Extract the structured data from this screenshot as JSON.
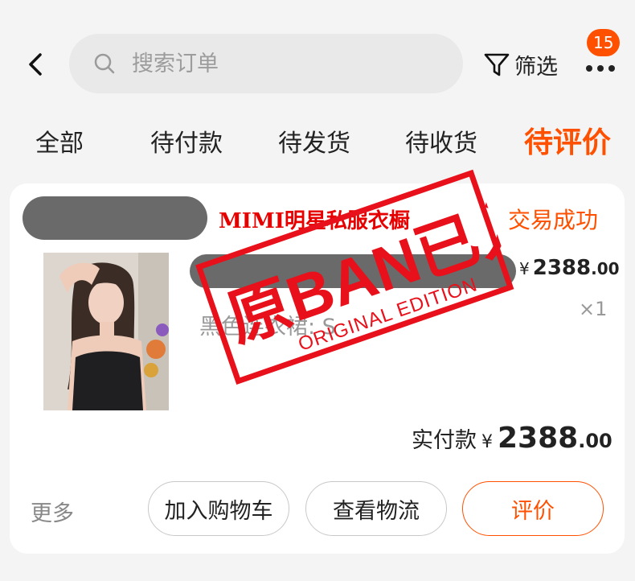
{
  "search": {
    "placeholder": "搜索订单"
  },
  "header": {
    "filter_label": "筛选",
    "more_badge": "15"
  },
  "tabs": [
    {
      "label": "全部",
      "active": false
    },
    {
      "label": "待付款",
      "active": false
    },
    {
      "label": "待发货",
      "active": false
    },
    {
      "label": "待收货",
      "active": false
    },
    {
      "label": "待评价",
      "active": true
    }
  ],
  "order": {
    "shop_name": "MIMI明星私服衣橱",
    "status": "交易成功",
    "item": {
      "price_currency": "¥",
      "price_int": "2388",
      "price_dec": ".00",
      "sku": "黑色连衣裙: S",
      "quantity": "×1"
    },
    "paid": {
      "label": "实付款",
      "currency": "¥",
      "amount_int": "2388",
      "amount_dec": ".00"
    },
    "actions": {
      "more": "更多",
      "add_to_cart": "加入购物车",
      "view_logistics": "查看物流",
      "review": "评价"
    }
  },
  "stamp": {
    "main": "原BAN已入",
    "sub": "ORIGINAL EDITION"
  },
  "colors": {
    "accent": "#ff5000",
    "shop_name": "#e60000",
    "stamp": "#e8101a"
  }
}
